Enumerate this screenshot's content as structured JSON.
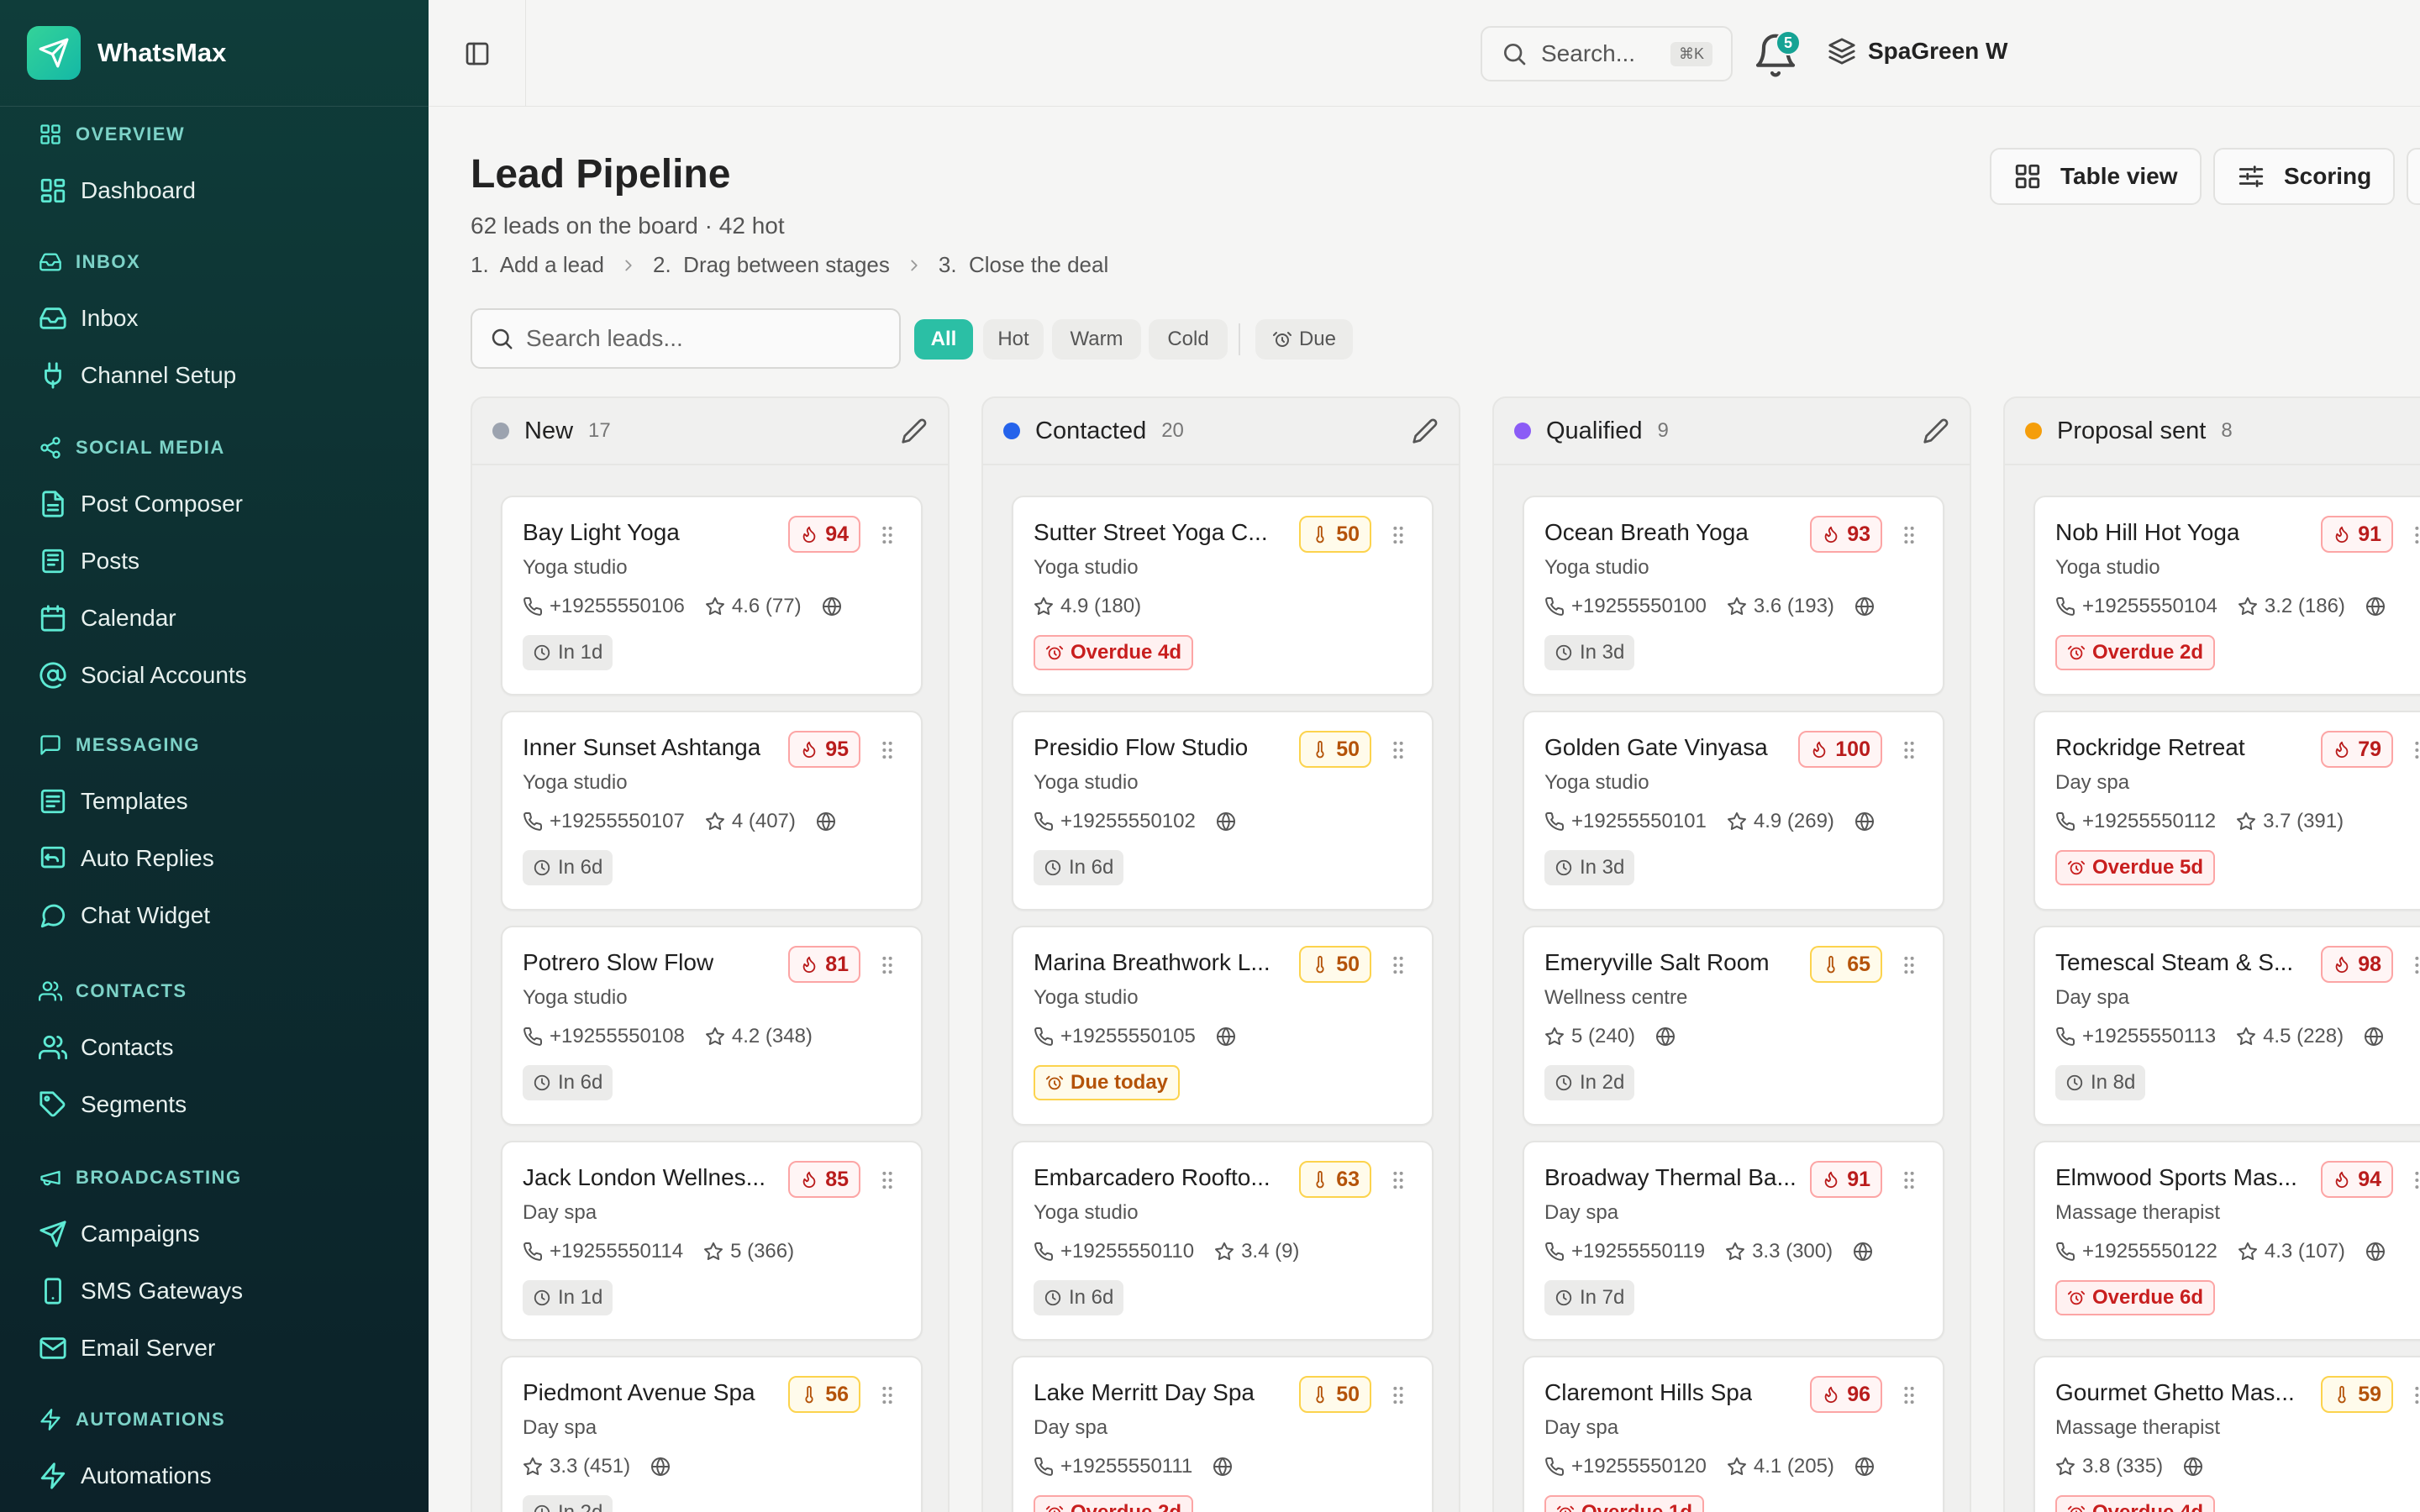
{
  "app": {
    "name": "WhatsMax"
  },
  "sidebar": {
    "sections": [
      {
        "title": "OVERVIEW",
        "icon": "grid-icon",
        "items": [
          {
            "label": "Dashboard",
            "icon": "dashboard-icon"
          }
        ]
      },
      {
        "title": "INBOX",
        "icon": "inbox-icon",
        "items": [
          {
            "label": "Inbox",
            "icon": "inbox-icon"
          },
          {
            "label": "Channel Setup",
            "icon": "plug-icon"
          }
        ]
      },
      {
        "title": "SOCIAL MEDIA",
        "icon": "share-icon",
        "items": [
          {
            "label": "Post Composer",
            "icon": "document-icon"
          },
          {
            "label": "Posts",
            "icon": "newspaper-icon"
          },
          {
            "label": "Calendar",
            "icon": "calendar-icon"
          },
          {
            "label": "Social Accounts",
            "icon": "at-sign-icon"
          }
        ]
      },
      {
        "title": "MESSAGING",
        "icon": "message-square-icon",
        "items": [
          {
            "label": "Templates",
            "icon": "template-icon"
          },
          {
            "label": "Auto Replies",
            "icon": "reply-icon"
          },
          {
            "label": "Chat Widget",
            "icon": "chat-bubble-icon"
          }
        ]
      },
      {
        "title": "CONTACTS",
        "icon": "users-icon",
        "items": [
          {
            "label": "Contacts",
            "icon": "users-icon"
          },
          {
            "label": "Segments",
            "icon": "tag-icon"
          }
        ]
      },
      {
        "title": "BROADCASTING",
        "icon": "megaphone-icon",
        "items": [
          {
            "label": "Campaigns",
            "icon": "send-icon"
          },
          {
            "label": "SMS Gateways",
            "icon": "smartphone-icon"
          },
          {
            "label": "Email Server",
            "icon": "mail-icon"
          }
        ]
      },
      {
        "title": "AUTOMATIONS",
        "icon": "zap-icon",
        "items": [
          {
            "label": "Automations",
            "icon": "zap-icon"
          }
        ]
      }
    ]
  },
  "topbar": {
    "search_label": "Search...",
    "shortcut": "⌘K",
    "notifications": "5",
    "workspace": "SpaGreen W"
  },
  "header": {
    "title": "Lead Pipeline",
    "subtitle": "62 leads on the board · 42 hot",
    "steps": [
      "1.  Add a lead",
      "2.  Drag between stages",
      "3.  Close the deal"
    ],
    "buttons": {
      "table_view": "Table view",
      "scoring": "Scoring"
    }
  },
  "filters": {
    "search_placeholder": "Search leads...",
    "chips": [
      "All",
      "Hot",
      "Warm",
      "Cold"
    ],
    "due_label": "Due"
  },
  "colors": {
    "accent": "#2bbfa5",
    "new": "#9ca3af",
    "contacted": "#2563eb",
    "qualified": "#8b5cf6",
    "proposal": "#f59e0b"
  },
  "columns": [
    {
      "name": "New",
      "count": "17",
      "color": "#9ca3af",
      "cards": [
        {
          "name": "Bay Light Yoga",
          "type": "Yoga studio",
          "score": "94",
          "level": "hot",
          "phone": "+19255550106",
          "rating": "4.6 (77)",
          "web": true,
          "due": "In 1d",
          "due_kind": "neutral"
        },
        {
          "name": "Inner Sunset Ashtanga",
          "type": "Yoga studio",
          "score": "95",
          "level": "hot",
          "phone": "+19255550107",
          "rating": "4 (407)",
          "web": true,
          "due": "In 6d",
          "due_kind": "neutral"
        },
        {
          "name": "Potrero Slow Flow",
          "type": "Yoga studio",
          "score": "81",
          "level": "hot",
          "phone": "+19255550108",
          "rating": "4.2 (348)",
          "web": false,
          "due": "In 6d",
          "due_kind": "neutral"
        },
        {
          "name": "Jack London Wellnes...",
          "type": "Day spa",
          "score": "85",
          "level": "hot",
          "phone": "+19255550114",
          "rating": "5 (366)",
          "web": false,
          "due": "In 1d",
          "due_kind": "neutral"
        },
        {
          "name": "Piedmont Avenue Spa",
          "type": "Day spa",
          "score": "56",
          "level": "warm",
          "phone": "",
          "rating": "3.3 (451)",
          "web": true,
          "due": "In 2d",
          "due_kind": "neutral"
        }
      ]
    },
    {
      "name": "Contacted",
      "count": "20",
      "color": "#2563eb",
      "cards": [
        {
          "name": "Sutter Street Yoga C...",
          "type": "Yoga studio",
          "score": "50",
          "level": "warm",
          "phone": "",
          "rating": "4.9 (180)",
          "web": false,
          "due": "Overdue 4d",
          "due_kind": "overdue"
        },
        {
          "name": "Presidio Flow Studio",
          "type": "Yoga studio",
          "score": "50",
          "level": "warm",
          "phone": "+19255550102",
          "rating": "",
          "web": true,
          "due": "In 6d",
          "due_kind": "neutral"
        },
        {
          "name": "Marina Breathwork L...",
          "type": "Yoga studio",
          "score": "50",
          "level": "warm",
          "phone": "+19255550105",
          "rating": "",
          "web": true,
          "due": "Due today",
          "due_kind": "today"
        },
        {
          "name": "Embarcadero Roofto...",
          "type": "Yoga studio",
          "score": "63",
          "level": "warm",
          "phone": "+19255550110",
          "rating": "3.4 (9)",
          "web": false,
          "due": "In 6d",
          "due_kind": "neutral"
        },
        {
          "name": "Lake Merritt Day Spa",
          "type": "Day spa",
          "score": "50",
          "level": "warm",
          "phone": "+19255550111",
          "rating": "",
          "web": true,
          "due": "Overdue 2d",
          "due_kind": "overdue"
        }
      ]
    },
    {
      "name": "Qualified",
      "count": "9",
      "color": "#8b5cf6",
      "cards": [
        {
          "name": "Ocean Breath Yoga",
          "type": "Yoga studio",
          "score": "93",
          "level": "hot",
          "phone": "+19255550100",
          "rating": "3.6 (193)",
          "web": true,
          "due": "In 3d",
          "due_kind": "neutral"
        },
        {
          "name": "Golden Gate Vinyasa",
          "type": "Yoga studio",
          "score": "100",
          "level": "hot",
          "phone": "+19255550101",
          "rating": "4.9 (269)",
          "web": true,
          "due": "In 3d",
          "due_kind": "neutral"
        },
        {
          "name": "Emeryville Salt Room",
          "type": "Wellness centre",
          "score": "65",
          "level": "warm",
          "phone": "",
          "rating": "5 (240)",
          "web": true,
          "due": "In 2d",
          "due_kind": "neutral"
        },
        {
          "name": "Broadway Thermal Ba...",
          "type": "Day spa",
          "score": "91",
          "level": "hot",
          "phone": "+19255550119",
          "rating": "3.3 (300)",
          "web": true,
          "due": "In 7d",
          "due_kind": "neutral"
        },
        {
          "name": "Claremont Hills Spa",
          "type": "Day spa",
          "score": "96",
          "level": "hot",
          "phone": "+19255550120",
          "rating": "4.1 (205)",
          "web": true,
          "due": "Overdue 1d",
          "due_kind": "overdue"
        }
      ]
    },
    {
      "name": "Proposal sent",
      "count": "8",
      "color": "#f59e0b",
      "cards": [
        {
          "name": "Nob Hill Hot Yoga",
          "type": "Yoga studio",
          "score": "91",
          "level": "hot",
          "phone": "+19255550104",
          "rating": "3.2 (186)",
          "web": true,
          "due": "Overdue 2d",
          "due_kind": "overdue"
        },
        {
          "name": "Rockridge Retreat",
          "type": "Day spa",
          "score": "79",
          "level": "hot",
          "phone": "+19255550112",
          "rating": "3.7 (391)",
          "web": false,
          "due": "Overdue 5d",
          "due_kind": "overdue"
        },
        {
          "name": "Temescal Steam & S...",
          "type": "Day spa",
          "score": "98",
          "level": "hot",
          "phone": "+19255550113",
          "rating": "4.5 (228)",
          "web": true,
          "due": "In 8d",
          "due_kind": "neutral"
        },
        {
          "name": "Elmwood Sports Mas...",
          "type": "Massage therapist",
          "score": "94",
          "level": "hot",
          "phone": "+19255550122",
          "rating": "4.3 (107)",
          "web": true,
          "due": "Overdue 6d",
          "due_kind": "overdue"
        },
        {
          "name": "Gourmet Ghetto Mas...",
          "type": "Massage therapist",
          "score": "59",
          "level": "warm",
          "phone": "",
          "rating": "3.8 (335)",
          "web": true,
          "due": "Overdue 4d",
          "due_kind": "overdue"
        }
      ]
    }
  ]
}
